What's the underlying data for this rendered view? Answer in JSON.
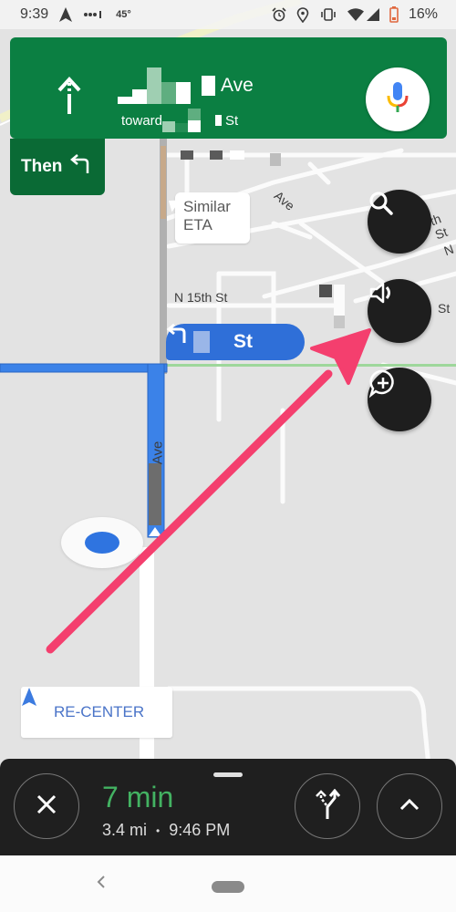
{
  "status_bar": {
    "time": "9:39",
    "temperature": "45°",
    "battery_percent": "16%",
    "icons": [
      "navigation-arrow-icon",
      "signal-dots-icon",
      "alarm-icon",
      "location-pin-icon",
      "vibrate-icon",
      "wifi-icon",
      "cell-signal-icon",
      "battery-low-icon"
    ]
  },
  "direction": {
    "maneuver_icon": "straight-arrow-icon",
    "street_suffix": "Ave",
    "toward_label": "toward",
    "toward_suffix": "St",
    "mic_icon": "google-mic-icon"
  },
  "then_card": {
    "label": "Then",
    "icon": "turn-left-icon"
  },
  "map": {
    "similar_eta": {
      "line1": "Similar",
      "line2": "ETA"
    },
    "labels": {
      "n15th": "N 15th St",
      "ave_top": "Ave",
      "ave_route": "Ave",
      "th_st": "th St",
      "n_cut": "N",
      "st_cut": "St"
    },
    "turn_bubble": {
      "icon": "turn-left-icon",
      "street_suffix": "St"
    },
    "route_color": "#3b82e8",
    "annotation_arrow_color": "#f43f6e"
  },
  "fabs": {
    "search": "search-icon",
    "sound": "volume-icon",
    "report": "add-report-icon"
  },
  "recenter": {
    "label": "RE-CENTER",
    "icon": "navigation-arrow-icon"
  },
  "trip": {
    "eta_time": "7 min",
    "distance": "3.4 mi",
    "separator": "•",
    "arrival": "9:46 PM",
    "close_icon": "close-icon",
    "alternate_routes_icon": "fork-routes-icon",
    "expand_icon": "chevron-up-icon"
  },
  "nav_bar": {
    "back_icon": "back-chevron-icon",
    "home_icon": "home-pill-icon"
  }
}
